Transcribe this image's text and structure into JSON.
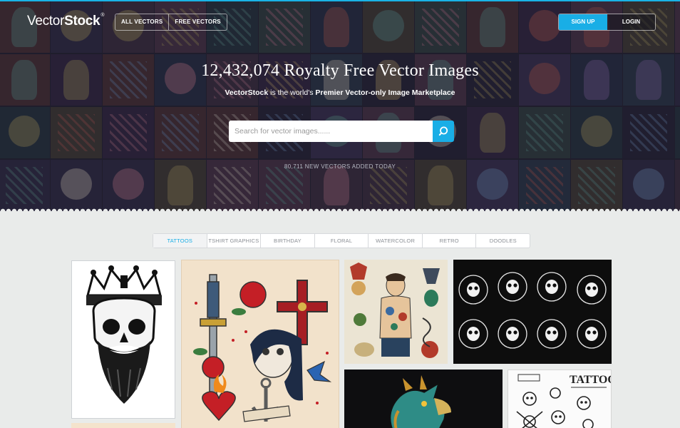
{
  "header": {
    "logo_light": "Vector",
    "logo_bold": "Stock",
    "logo_mark": "®",
    "nav": [
      "ALL VECTORS",
      "FREE VECTORS"
    ],
    "signup": "SIGN UP",
    "login": "LOGIN"
  },
  "hero": {
    "headline": "12,432,074 Royalty Free Vector Images",
    "sub_brand": "VectorStock",
    "sub_mid": " is the world's ",
    "sub_bold": "Premier Vector-only Image Marketplace",
    "search_placeholder": "Search for vector images......",
    "added_today": "80,711 NEW VECTORS ADDED TODAY"
  },
  "tabs": [
    "TATTOOS",
    "TSHIRT GRAPHICS",
    "BIRTHDAY",
    "FLORAL",
    "WATERCOLOR",
    "RETRO",
    "DOODLES"
  ],
  "active_tab": "TATTOOS",
  "gallery": {
    "tattoo_text": "TATTOO"
  },
  "colors": {
    "accent": "#19aee6",
    "page_bg": "#e9ebea"
  },
  "icons": {
    "search_button": "search-icon"
  }
}
